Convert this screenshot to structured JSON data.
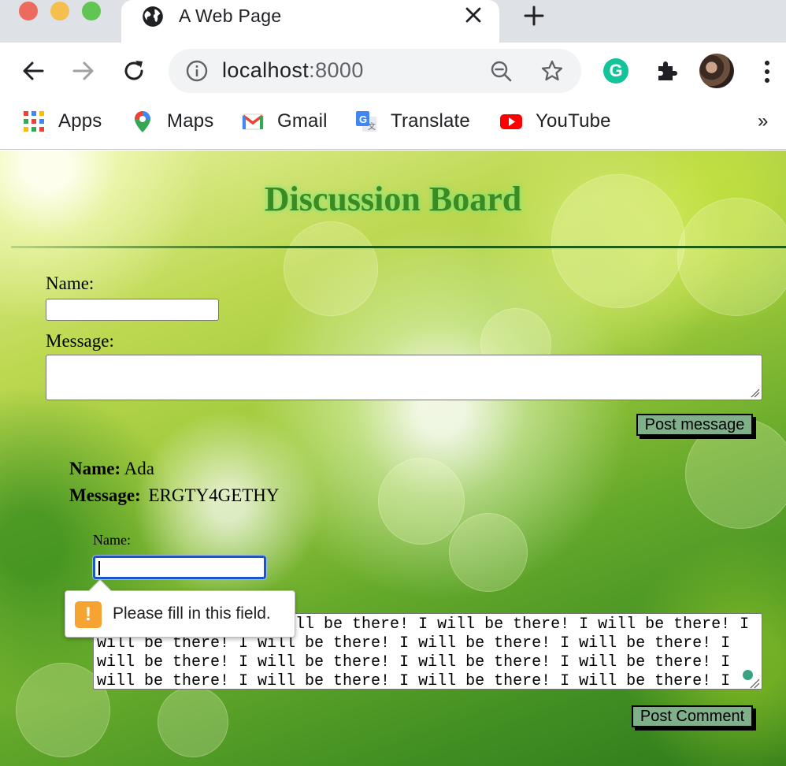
{
  "browser": {
    "tab_title": "A Web Page",
    "url_host": "localhost",
    "url_port": ":8000",
    "grammarly_letter": "G",
    "bookmarks": [
      {
        "label": "Apps",
        "icon": "apps-grid-icon"
      },
      {
        "label": "Maps",
        "icon": "maps-pin-icon"
      },
      {
        "label": "Gmail",
        "icon": "gmail-icon"
      },
      {
        "label": "Translate",
        "icon": "translate-icon"
      },
      {
        "label": "YouTube",
        "icon": "youtube-icon"
      }
    ],
    "more_bookmarks": "»"
  },
  "page": {
    "title": "Discussion Board",
    "form": {
      "name_label": "Name:",
      "name_value": "",
      "message_label": "Message:",
      "message_value": "",
      "post_button": "Post message"
    },
    "posts": [
      {
        "name_label": "Name:",
        "name": "Ada",
        "message_label": "Message:",
        "message": "ERGTY4GETHY",
        "comment_form": {
          "name_label": "Name:",
          "name_value": "",
          "comment_value": "I will be there! I will be there! I will be there! I will be there! I will be there! I will be there! I will be there! I will be there! I will be there! I will be there! I will be there! I will be there! I will be there! I will be there! I will be there! I will be there! I will be there! I will be there! I will be there! I will be there!",
          "post_button": "Post Comment"
        }
      }
    ],
    "validation_tooltip": "Please fill in this field.",
    "validation_icon": "!"
  },
  "colors": {
    "title_green": "#3b8a22",
    "button_bg": "#7fb08a",
    "focus_blue": "#1a56c8",
    "warning_orange": "#f6a431"
  }
}
